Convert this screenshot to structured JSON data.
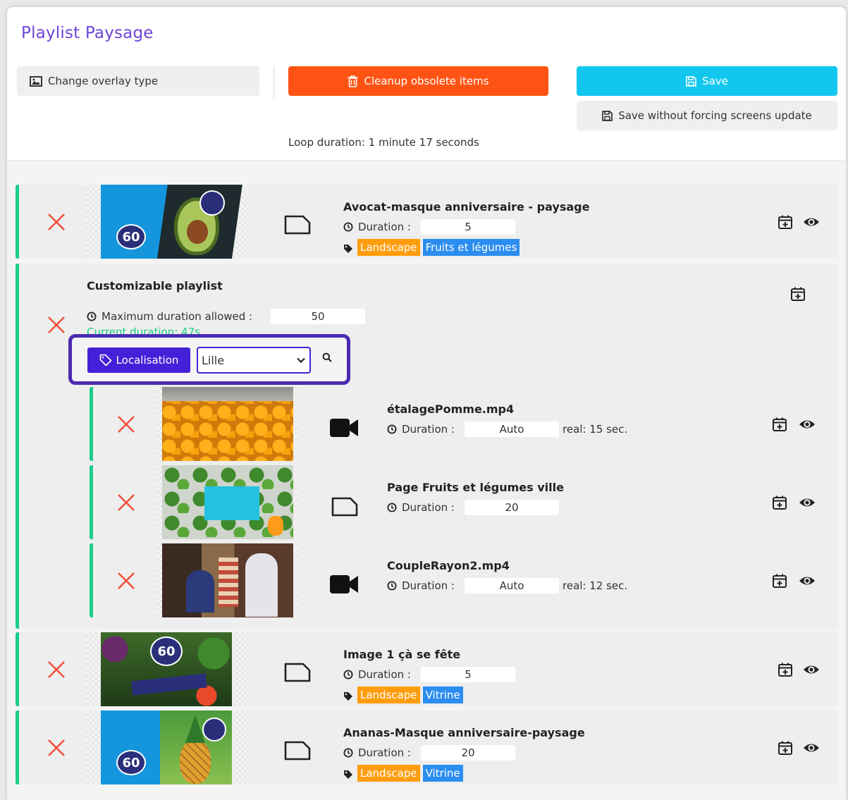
{
  "header": {
    "title": "Playlist Paysage",
    "change_overlay_label": "Change overlay type",
    "cleanup_label": "Cleanup obsolete items",
    "save_label": "Save",
    "save_no_force_label": "Save without forcing screens update",
    "loop_duration": "Loop duration: 1 minute 17 seconds"
  },
  "labels": {
    "duration": "Duration :",
    "max_duration": "Maximum duration allowed :",
    "current_duration": "Current duration: 47s"
  },
  "items": [
    {
      "name": "Avocat-masque anniversaire - paysage",
      "duration": "5",
      "tags": [
        "Landscape",
        "Fruits et légumes"
      ],
      "thumb_text": "60"
    },
    {
      "name": "Image 1 çà se fête",
      "duration": "5",
      "tags": [
        "Landscape",
        "Vitrine"
      ],
      "thumb_text": "60"
    },
    {
      "name": "Ananas-Masque anniversaire-paysage",
      "duration": "20",
      "tags": [
        "Landscape",
        "Vitrine"
      ],
      "thumb_text": "60"
    }
  ],
  "group": {
    "title": "Customizable playlist",
    "max_duration": "50",
    "localisation_label": "Localisation",
    "localisation_value": "Lille",
    "sub_items": [
      {
        "name": "étalagePomme.mp4",
        "duration": "Auto",
        "real": "real: 15 sec."
      },
      {
        "name": "Page Fruits et légumes ville",
        "duration": "20",
        "real": ""
      },
      {
        "name": "CoupleRayon2.mp4",
        "duration": "Auto",
        "real": "real: 12 sec."
      }
    ]
  },
  "colors": {
    "accent_purple": "#6f45d8",
    "cleanup_orange": "#ff5314",
    "save_cyan": "#12c7ee",
    "row_border_green": "#1ccd8a",
    "tag_orange": "#ff9d0e",
    "tag_blue": "#2b8df0",
    "delete_red": "#f0503c"
  },
  "icons": {
    "delete": "close-x-icon",
    "image_type": "page-icon",
    "video_type": "video-camera-icon",
    "schedule": "calendar-plus-icon",
    "preview": "eye-icon",
    "clock": "clock-icon",
    "tag": "tag-icon",
    "search": "search-icon"
  }
}
